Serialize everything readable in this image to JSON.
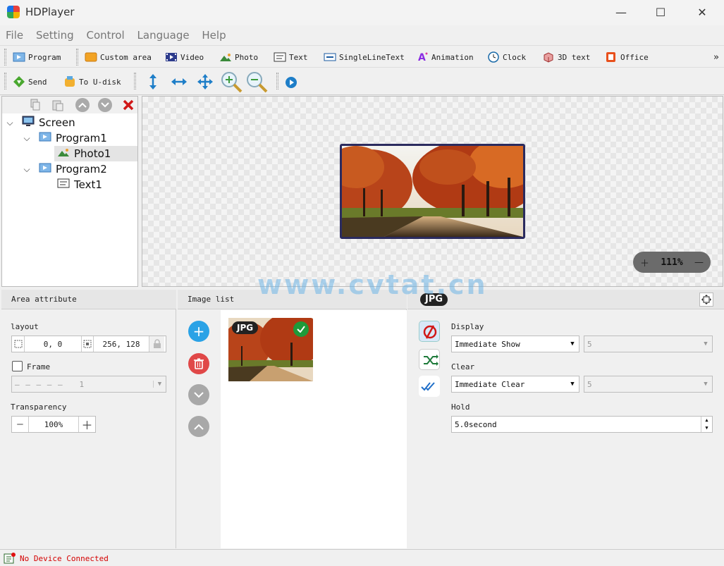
{
  "window": {
    "title": "HDPlayer",
    "minimize": "—",
    "maximize": "☐",
    "close": "✕"
  },
  "menu": [
    "File",
    "Setting",
    "Control",
    "Language",
    "Help"
  ],
  "toolbar1": [
    {
      "label": "Program",
      "icon": "program-icon"
    },
    {
      "label": "Custom area",
      "icon": "custom-area-icon"
    },
    {
      "label": "Video",
      "icon": "video-icon"
    },
    {
      "label": "Photo",
      "icon": "photo-icon"
    },
    {
      "label": "Text",
      "icon": "text-icon"
    },
    {
      "label": "SingleLineText",
      "icon": "single-line-text-icon"
    },
    {
      "label": "Animation",
      "icon": "animation-icon"
    },
    {
      "label": "Clock",
      "icon": "clock-icon"
    },
    {
      "label": "3D text",
      "icon": "3d-text-icon"
    },
    {
      "label": "Office",
      "icon": "office-icon"
    }
  ],
  "toolbar1_overflow": "»",
  "toolbar2": {
    "send": "Send",
    "udisk": "To U-disk"
  },
  "tree": {
    "screen": "Screen",
    "program1": "Program1",
    "photo1": "Photo1",
    "program2": "Program2",
    "text1": "Text1"
  },
  "canvas": {
    "zoom": "111%"
  },
  "area_attribute": {
    "title": "Area attribute",
    "layout_label": "layout",
    "position": "0, 0",
    "size": "256, 128",
    "frame_label": "Frame",
    "frame_value": "1",
    "transparency_label": "Transparency",
    "transparency_value": "100%"
  },
  "image_list": {
    "title": "Image list",
    "thumb_badge": "JPG"
  },
  "effects": {
    "badge": "JPG",
    "display_label": "Display",
    "display_value": "Immediate Show",
    "display_speed": "5",
    "clear_label": "Clear",
    "clear_value": "Immediate Clear",
    "clear_speed": "5",
    "hold_label": "Hold",
    "hold_value": "5.0second"
  },
  "status": {
    "text": "No Device Connected"
  },
  "watermark": "www.cvtat.cn",
  "colors": {
    "add": "#2aa2e6",
    "delete": "#e04848",
    "round_gray": "#a8a8a8",
    "status_red": "#d40000"
  }
}
